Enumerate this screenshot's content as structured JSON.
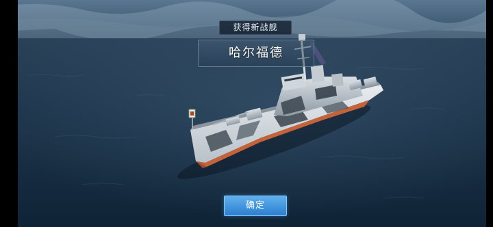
{
  "reward": {
    "badge_label": "获得新战舰",
    "ship_name": "哈尔福德",
    "confirm_label": "确定"
  },
  "ship": {
    "flag": "ensign"
  },
  "colors": {
    "sea": "#1d3448",
    "sky": "#4f6b82",
    "confirm_button": "#3a8ddc",
    "hull_boot_top": "#c4623a"
  }
}
